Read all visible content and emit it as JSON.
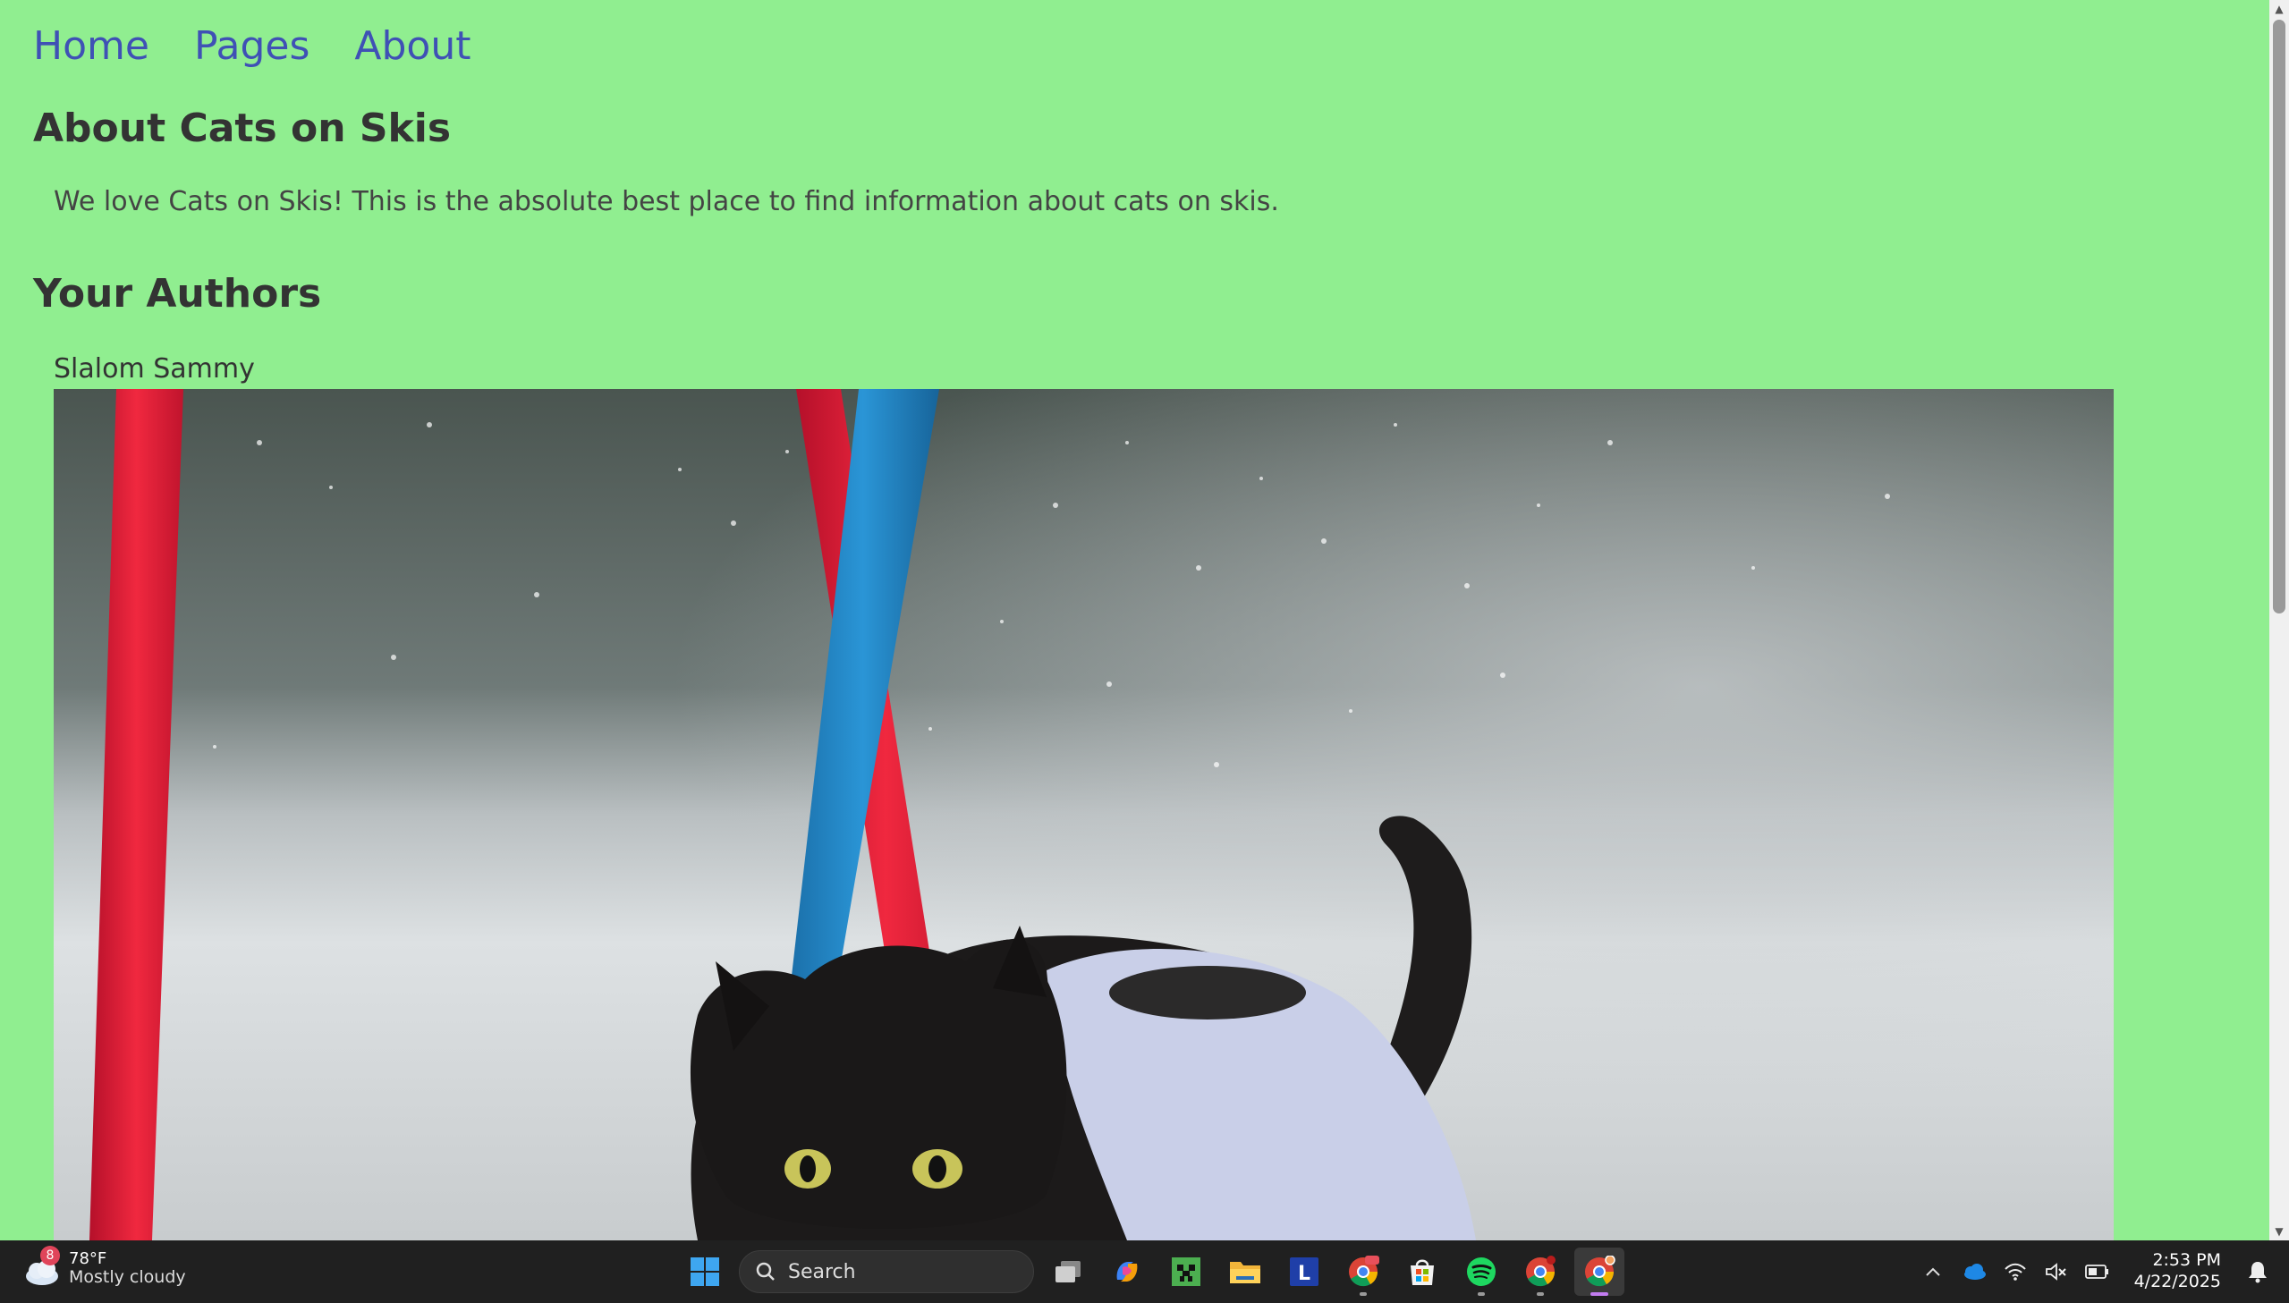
{
  "nav": {
    "home": "Home",
    "pages": "Pages",
    "about": "About"
  },
  "page": {
    "title": "About Cats on Skis",
    "intro": "We love Cats on Skis! This is the absolute best place to find information about cats on skis.",
    "authors_title": "Your Authors",
    "authors": [
      {
        "name": "Slalom Sammy"
      }
    ]
  },
  "taskbar": {
    "weather": {
      "badge": "8",
      "temp": "78°F",
      "condition": "Mostly cloudy"
    },
    "search_label": "Search",
    "clock": {
      "time": "2:53 PM",
      "date": "4/22/2025"
    },
    "apps": [
      "windows-start",
      "search",
      "task-view",
      "copilot",
      "minecraft",
      "file-explorer",
      "l-app",
      "chrome-beta",
      "microsoft-store",
      "spotify",
      "chrome",
      "chrome-canary"
    ]
  },
  "colors": {
    "background": "#90ee90",
    "link": "#3f51b5",
    "text": "#333333",
    "taskbar": "#202020"
  }
}
